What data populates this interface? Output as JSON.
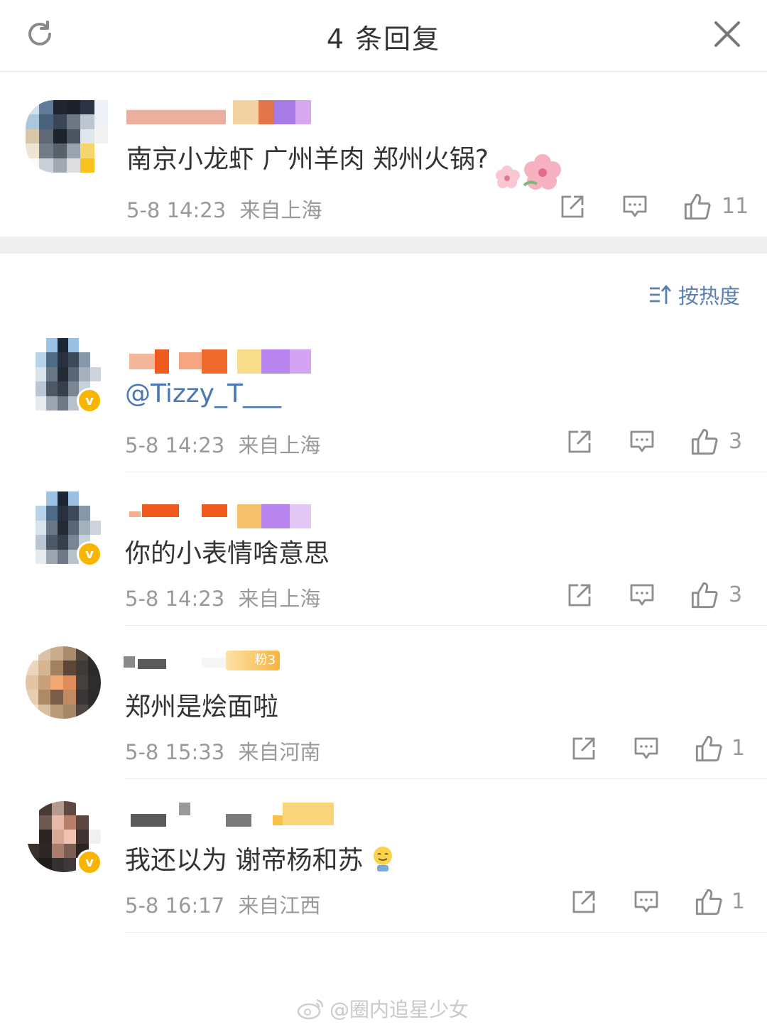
{
  "header": {
    "title": "4 条回复",
    "refresh_icon": "refresh-icon",
    "close_icon": "close-icon"
  },
  "root_comment": {
    "text": "南京小龙虾 广州羊肉 郑州火锅?",
    "time": "5-8 14:23",
    "location": "来自上海",
    "likes": "11"
  },
  "sort_label": "按热度",
  "replies": [
    {
      "text": "@Tizzy_T___",
      "time": "5-8 14:23",
      "location": "来自上海",
      "likes": "3"
    },
    {
      "text": "你的小表情啥意思",
      "time": "5-8 14:23",
      "location": "来自上海",
      "likes": "3"
    },
    {
      "text": "郑州是烩面啦",
      "time": "5-8 15:33",
      "location": "来自河南",
      "likes": "1",
      "badge": "粉3"
    },
    {
      "text": "我还以为 谢帝杨和苏",
      "time": "5-8 16:17",
      "location": "来自江西",
      "likes": "1"
    }
  ],
  "watermark": "@圈内追星少女",
  "colors": {
    "link": "#4a77b6",
    "meta": "#999999",
    "verified": "#f7b500",
    "separator": "#efefef"
  }
}
